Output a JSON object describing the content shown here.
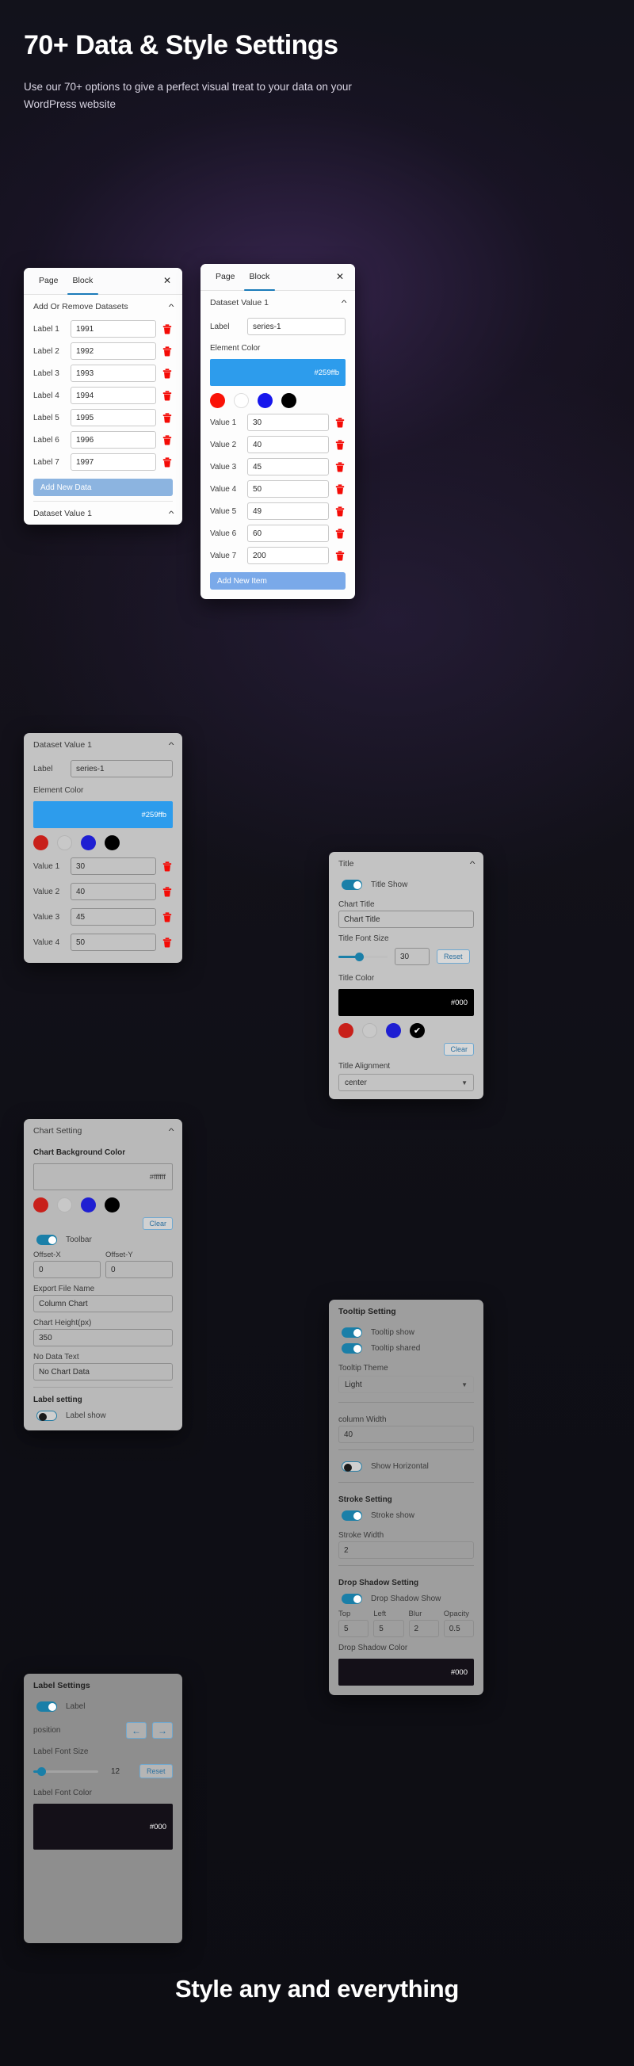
{
  "hero": {
    "title": "70+ Data & Style Settings",
    "subtitle": "Use our 70+ options to give a perfect visual treat to your data on your WordPress website"
  },
  "footer": {
    "text": "Style any and everything"
  },
  "icons": {
    "close": "close-icon",
    "chevron_up": "chevron-up-icon",
    "chevron_down": "chevron-down-icon",
    "trash": "trash-icon",
    "arrow_left": "←",
    "arrow_right": "→",
    "check": "✔"
  },
  "panel_datasets": {
    "tabs": [
      {
        "label": "Page",
        "active": false
      },
      {
        "label": "Block",
        "active": true
      }
    ],
    "close_label": "✕",
    "section_title": "Add Or Remove Datasets",
    "rows": [
      {
        "label": "Label 1",
        "value": "1991"
      },
      {
        "label": "Label 2",
        "value": "1992"
      },
      {
        "label": "Label 3",
        "value": "1993"
      },
      {
        "label": "Label 4",
        "value": "1994"
      },
      {
        "label": "Label 5",
        "value": "1995"
      },
      {
        "label": "Label 6",
        "value": "1996"
      },
      {
        "label": "Label 7",
        "value": "1997"
      }
    ],
    "add_button": "Add New Data",
    "next_section": "Dataset Value 1"
  },
  "panel_dataset_value_right": {
    "tabs": [
      {
        "label": "Page",
        "active": false
      },
      {
        "label": "Block",
        "active": true
      }
    ],
    "close_label": "✕",
    "section_title": "Dataset Value 1",
    "label_caption": "Label",
    "label_value": "series-1",
    "element_color_caption": "Element Color",
    "element_color_hex": "#259ffb",
    "swatches": [
      "#fa1207",
      "#ffffff",
      "#1717ec",
      "#000000"
    ],
    "values": [
      {
        "label": "Value 1",
        "value": "30"
      },
      {
        "label": "Value 2",
        "value": "40"
      },
      {
        "label": "Value 3",
        "value": "45"
      },
      {
        "label": "Value 4",
        "value": "50"
      },
      {
        "label": "Value 5",
        "value": "49"
      },
      {
        "label": "Value 6",
        "value": "60"
      },
      {
        "label": "Value 7",
        "value": "200"
      }
    ],
    "add_button": "Add New Item"
  },
  "panel_dataset_value_left": {
    "section_title": "Dataset Value 1",
    "label_caption": "Label",
    "label_value": "series-1",
    "element_color_caption": "Element Color",
    "element_color_hex": "#259ffb",
    "swatches": [
      "#fa1207",
      "#ffffff",
      "#1717ec",
      "#000000"
    ],
    "values": [
      {
        "label": "Value 1",
        "value": "30"
      },
      {
        "label": "Value 2",
        "value": "40"
      },
      {
        "label": "Value 3",
        "value": "45"
      },
      {
        "label": "Value 4",
        "value": "50"
      }
    ]
  },
  "panel_title": {
    "section_title": "Title",
    "title_show_label": "Title Show",
    "title_show_on": true,
    "chart_title_caption": "Chart Title",
    "chart_title_value": "Chart Title",
    "font_size_caption": "Title Font Size",
    "font_size_value": "30",
    "reset_label": "Reset",
    "title_color_caption": "Title Color",
    "title_color_hex": "#000",
    "swatches": [
      "#c8201a",
      "#c8c8c8",
      "#1f1fd2",
      "#000000"
    ],
    "selected_swatch_index": 3,
    "clear_label": "Clear",
    "alignment_caption": "Title Alignment",
    "alignment_value": "center"
  },
  "panel_chart_setting": {
    "section_title": "Chart Setting",
    "bg_color_caption": "Chart Background Color",
    "bg_color_hex": "#ffffff",
    "swatches": [
      "#c8201a",
      "#c8c8c8",
      "#1f1fd2",
      "#000000"
    ],
    "clear_label": "Clear",
    "toolbar_label": "Toolbar",
    "toolbar_on": true,
    "offset_x_caption": "Offset-X",
    "offset_x_value": "0",
    "offset_y_caption": "Offset-Y",
    "offset_y_value": "0",
    "export_caption": "Export File Name",
    "export_value": "Column Chart",
    "height_caption": "Chart Height(px)",
    "height_value": "350",
    "nodata_caption": "No Data Text",
    "nodata_value": "No Chart Data",
    "label_setting_caption": "Label setting",
    "label_show_label": "Label show",
    "label_show_on": false
  },
  "panel_tooltip": {
    "section_title": "Tooltip Setting",
    "tooltip_show_label": "Tooltip show",
    "tooltip_show_on": true,
    "tooltip_shared_label": "Tooltip shared",
    "tooltip_shared_on": true,
    "theme_caption": "Tooltip Theme",
    "theme_value": "Light",
    "column_width_caption": "column Width",
    "column_width_value": "40",
    "show_horizontal_label": "Show Horizontal",
    "show_horizontal_on": false,
    "stroke_section": "Stroke Setting",
    "stroke_show_label": "Stroke show",
    "stroke_show_on": true,
    "stroke_width_caption": "Stroke Width",
    "stroke_width_value": "2",
    "dropshadow_section": "Drop Shadow Setting",
    "dropshadow_show_label": "Drop Shadow Show",
    "dropshadow_show_on": true,
    "ds_cols": [
      "Top",
      "Left",
      "Blur",
      "Opacity"
    ],
    "ds_values": [
      "5",
      "5",
      "2",
      "0.5"
    ],
    "ds_color_caption": "Drop Shadow Color",
    "ds_color_hex": "#000"
  },
  "panel_label_settings": {
    "section_title": "Label Settings",
    "label_toggle_label": "Label",
    "label_toggle_on": true,
    "position_caption": "position",
    "font_size_caption": "Label Font Size",
    "font_size_value": "12",
    "reset_label": "Reset",
    "font_color_caption": "Label Font Color",
    "font_color_hex": "#000"
  }
}
